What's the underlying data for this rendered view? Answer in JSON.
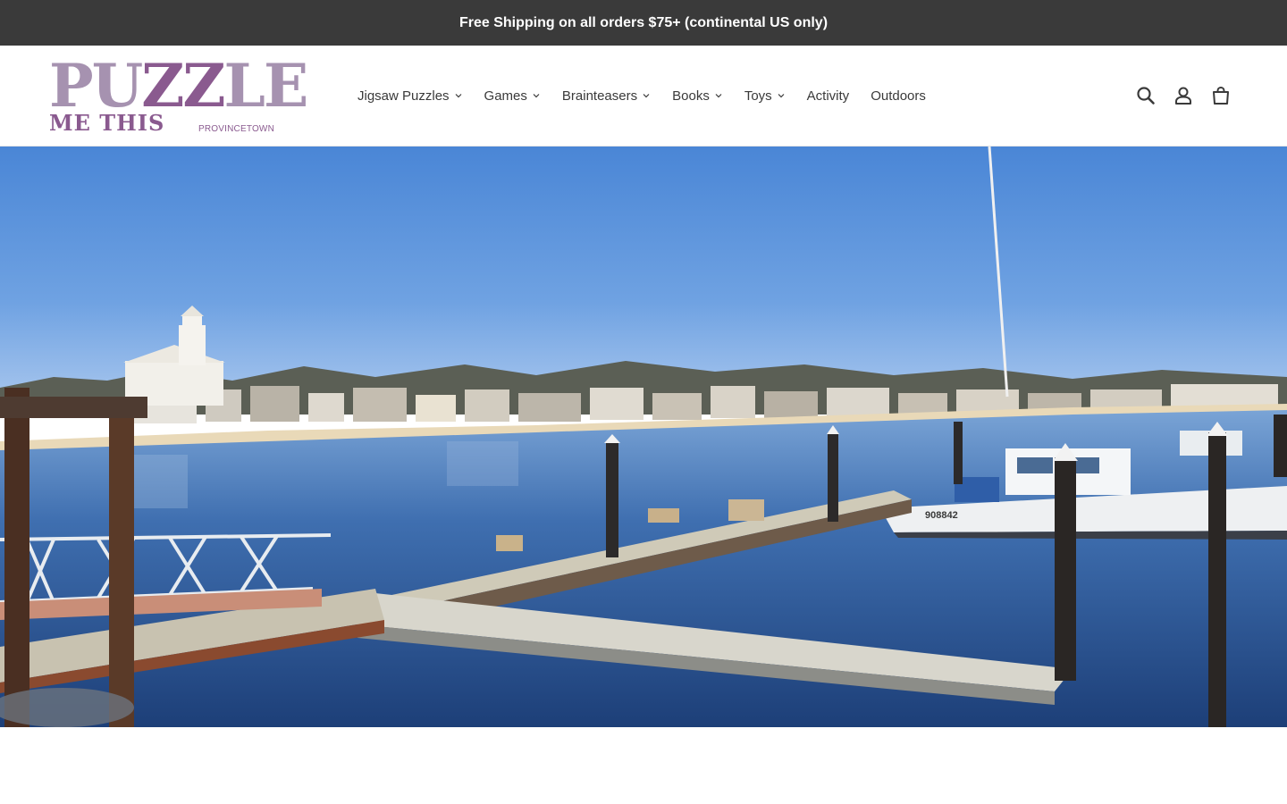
{
  "announcement": {
    "text": "Free Shipping on all orders $75+ (continental US only)"
  },
  "logo": {
    "line1_left": "PU",
    "line1_zz": "ZZ",
    "line1_right": "LE",
    "line2": "ME THIS",
    "tagline": "PROVINCETOWN"
  },
  "nav": {
    "items": [
      {
        "label": "Jigsaw Puzzles",
        "dropdown": true
      },
      {
        "label": "Games",
        "dropdown": true
      },
      {
        "label": "Brainteasers",
        "dropdown": true
      },
      {
        "label": "Books",
        "dropdown": true
      },
      {
        "label": "Toys",
        "dropdown": true
      },
      {
        "label": "Activity",
        "dropdown": false
      },
      {
        "label": "Outdoors",
        "dropdown": false
      }
    ]
  },
  "header_icons": [
    "search-icon",
    "account-icon",
    "cart-icon"
  ],
  "hero": {
    "boat_number": "908842"
  },
  "colors": {
    "announcement_bg": "#3a3a3a",
    "logo_light": "#a692b0",
    "logo_dark": "#8a5a8f",
    "text": "#3a3a3a"
  }
}
